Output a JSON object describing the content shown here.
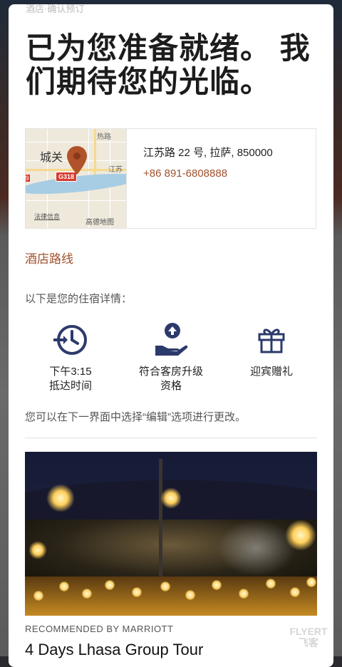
{
  "top_faded_text": "酒店·确认预订",
  "headline": "已为您准备就绪。 我们期待您的光临。",
  "map": {
    "city_label": "城关",
    "road_badge": "G318",
    "jiangsu_label": "江苏",
    "re_label": "热路",
    "legal_link": "法律信息",
    "provider_label": "高德地图"
  },
  "hotel": {
    "address": "江苏路 22 号, 拉萨, 850000",
    "phone": "+86 891-6808888"
  },
  "route_link": "酒店路线",
  "stay_intro": "以下是您的住宿详情：",
  "features": [
    {
      "icon": "arrival-clock-icon",
      "label_line1": "下午3:15",
      "label_line2": "抵达时间"
    },
    {
      "icon": "upgrade-hand-icon",
      "label_line1": "符合客房升级",
      "label_line2": "资格"
    },
    {
      "icon": "gift-icon",
      "label_line1": "迎宾赠礼",
      "label_line2": ""
    }
  ],
  "edit_note": "您可以在下一界面中选择“编辑”选项进行更改。",
  "recommendation": {
    "source": "RECOMMENDED BY MARRIOTT",
    "title": "4 Days Lhasa Group Tour"
  },
  "watermark": {
    "line1": "FLYERT",
    "line2": "飞客"
  },
  "colors": {
    "accent": "#a0522d",
    "icon_navy": "#2c3a6b",
    "text": "#222222"
  }
}
